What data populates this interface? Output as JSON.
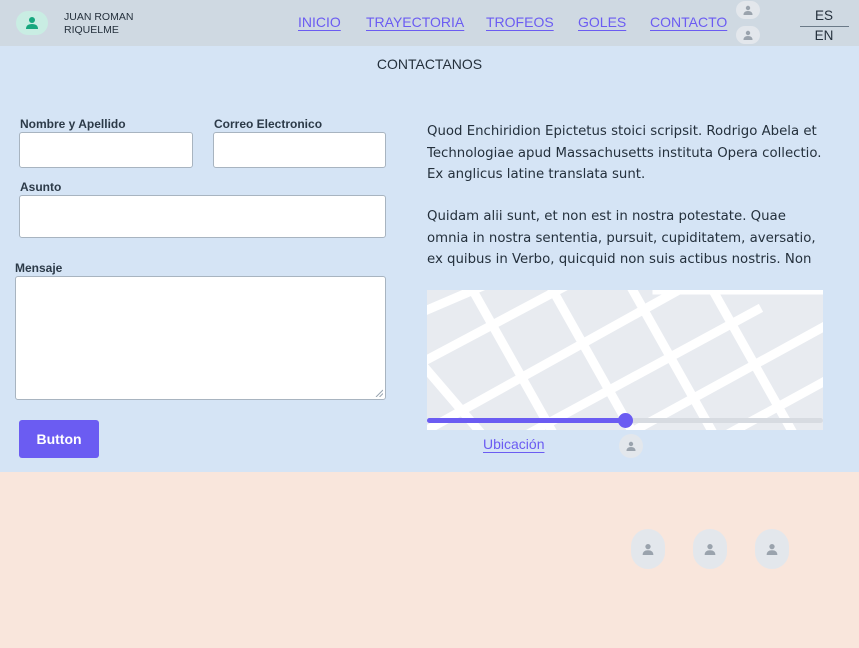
{
  "header": {
    "brand_name": "JUAN ROMAN RIQUELME",
    "brand_icon": "person-icon",
    "nav": [
      {
        "label": "INICIO"
      },
      {
        "label": "TRAYECTORIA"
      },
      {
        "label": "TROFEOS"
      },
      {
        "label": "GOLES"
      },
      {
        "label": "CONTACTO"
      }
    ],
    "languages": [
      "ES",
      "EN"
    ]
  },
  "contact": {
    "title": "CONTACTANOS",
    "form": {
      "name_label": "Nombre y Apellido",
      "email_label": "Correo Electronico",
      "subject_label": "Asunto",
      "message_label": "Mensaje",
      "name_value": "",
      "email_value": "",
      "subject_value": "",
      "message_value": "",
      "submit_label": "Button"
    },
    "paragraphs": [
      "Quod Enchiridion Epictetus stoici scripsit. Rodrigo Abela et Technologiae apud Massachusetts instituta Opera collectio. Ex anglicus latine translata sunt.",
      "Quidam alii sunt, et non est in nostra potestate. Quae omnia in nostra sententia, pursuit, cupiditatem, aversatio, ex quibus in Verbo, quicquid non suis actibus nostris. Non"
    ],
    "map": {
      "slider_value_percent": 50
    },
    "location_label": "Ubicación"
  },
  "colors": {
    "accent": "#6b5cf2",
    "header_bg": "#cfd9e2",
    "contact_bg": "#d5e4f5",
    "footer_bg": "#f9e6dc",
    "brand_avatar_bg": "#c9ede3",
    "brand_avatar_icon": "#17a77e"
  }
}
